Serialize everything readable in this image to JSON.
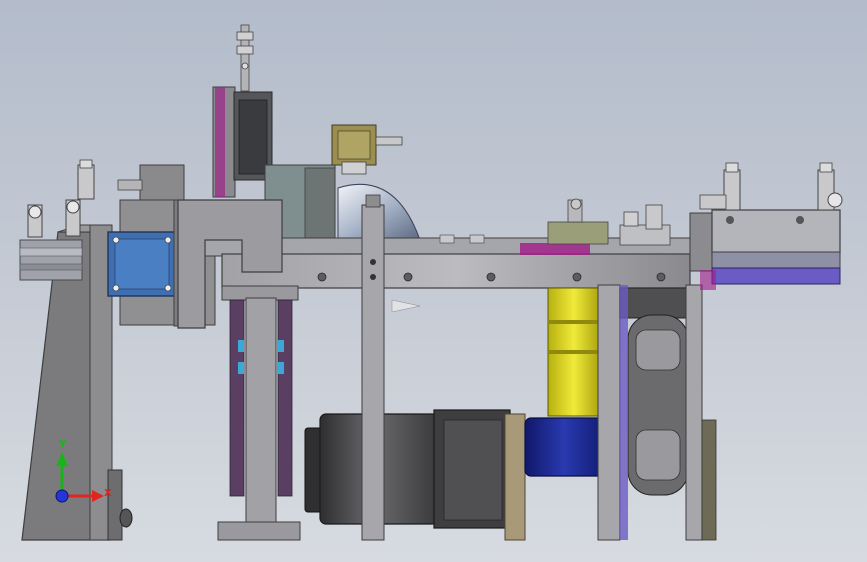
{
  "viewport": {
    "background_top": "#b3bccb",
    "background_bottom": "#d7dbe1"
  },
  "triad": {
    "y_label": "Y",
    "x_label": "X",
    "y_color": "#19b419",
    "x_color": "#e0261f",
    "z_color": "#2436d8"
  },
  "colors": {
    "steel": "#8e8e92",
    "steel_light": "#b6b6ba",
    "steel_dark": "#5f5f63",
    "motor_body": "#4a4a4c",
    "blue_motor": "#3f6fb0",
    "yellow_cylinder": "#d9d21a",
    "navy_block": "#1c2a8c",
    "purple_rail": "#6b5bc4",
    "magenta_accent": "#a21c8a",
    "brass": "#a89a78",
    "gear_green": "#9a9f7a"
  }
}
